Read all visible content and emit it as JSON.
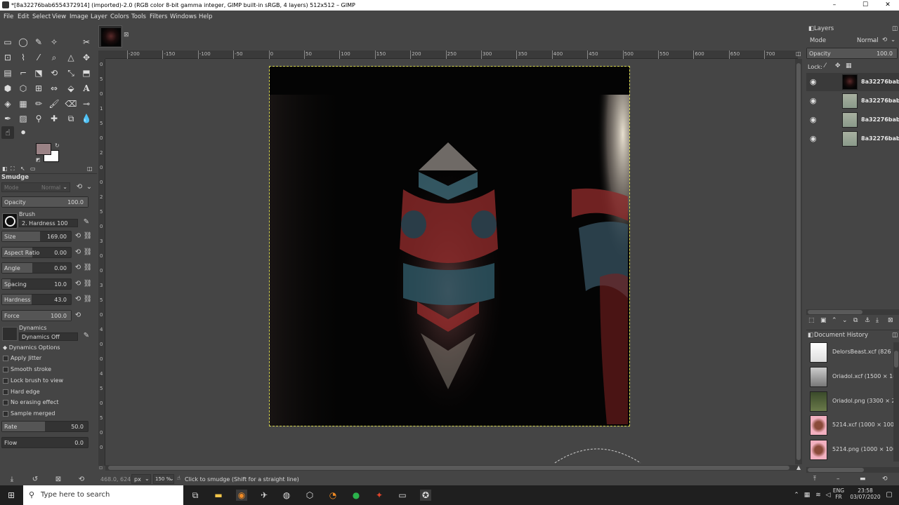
{
  "window": {
    "title": "*[8a32276bab6554372914] (imported)-2.0 (RGB color 8-bit gamma integer, GIMP built-in sRGB, 4 layers) 512x512 – GIMP",
    "min": "–",
    "max": "☐",
    "close": "✕"
  },
  "menu": [
    "File",
    "Edit",
    "Select",
    "View",
    "Image",
    "Layer",
    "Colors",
    "Tools",
    "Filters",
    "Windows",
    "Help"
  ],
  "tool_options": {
    "tool_name": "Smudge",
    "mode_label": "Mode",
    "mode_value": "Normal",
    "opacity_label": "Opacity",
    "opacity_value": "100.0",
    "brush_label": "Brush",
    "brush_value": "2. Hardness 100",
    "size_label": "Size",
    "size_value": "169.00",
    "size_frac": 0.55,
    "aspect_label": "Aspect Ratio",
    "aspect_value": "0.00",
    "angle_label": "Angle",
    "angle_value": "0.00",
    "spacing_label": "Spacing",
    "spacing_value": "10.0",
    "hardness_label": "Hardness",
    "hardness_value": "43.0",
    "hardness_frac": 0.43,
    "force_label": "Force",
    "force_value": "100.0",
    "dynamics_label": "Dynamics",
    "dynamics_value": "Dynamics Off",
    "dynamics_options": "Dynamics Options",
    "apply_jitter": "Apply Jitter",
    "smooth_stroke": "Smooth stroke",
    "lock_brush": "Lock brush to view",
    "hard_edge": "Hard edge",
    "no_erasing": "No erasing effect",
    "sample_merged": "Sample merged",
    "rate_label": "Rate",
    "rate_value": "50.0",
    "rate_frac": 0.5,
    "flow_label": "Flow",
    "flow_value": "0.0"
  },
  "colors": {
    "fg": "#9a8285",
    "bg": "#ffffff"
  },
  "ruler": [
    "-200",
    "-150",
    "-100",
    "-50",
    "0",
    "50",
    "100",
    "150",
    "200",
    "250",
    "300",
    "350",
    "400",
    "450",
    "500",
    "550",
    "600",
    "650",
    "700"
  ],
  "vruler": [
    "0",
    "5",
    "0",
    "1",
    "5",
    "0",
    "2",
    "0",
    "0",
    "2",
    "5",
    "0",
    "3",
    "0",
    "0",
    "3",
    "5",
    "0",
    "4",
    "0",
    "0",
    "4",
    "5",
    "0",
    "5",
    "0",
    "0"
  ],
  "status": {
    "coords": "468.0, 624.0",
    "unit": "px",
    "zoom": "150 %",
    "message": "Click to smudge (Shift for a straight line)"
  },
  "layers_panel": {
    "title": "Layers",
    "mode_label": "Mode",
    "mode_value": "Normal",
    "opacity_label": "Opacity",
    "opacity_value": "100.0",
    "lock_label": "Lock:",
    "layers": [
      {
        "name": "8a32276bab"
      },
      {
        "name": "8a32276bab"
      },
      {
        "name": "8a32276bab"
      },
      {
        "name": "8a32276bab"
      }
    ]
  },
  "history_panel": {
    "title": "Document History",
    "items": [
      {
        "name": "DelorsBeast.xcf (826"
      },
      {
        "name": "Oriadol.xcf (1500 × 1("
      },
      {
        "name": "Oriadol.png (3300 × 2"
      },
      {
        "name": "5214.xcf (1000 × 1000"
      },
      {
        "name": "5214.png (1000 × 100("
      }
    ]
  },
  "taskbar": {
    "search_placeholder": "Type here to search",
    "lang": "ENG",
    "region": "FR",
    "time": "23:58",
    "date": "03/07/2020"
  }
}
